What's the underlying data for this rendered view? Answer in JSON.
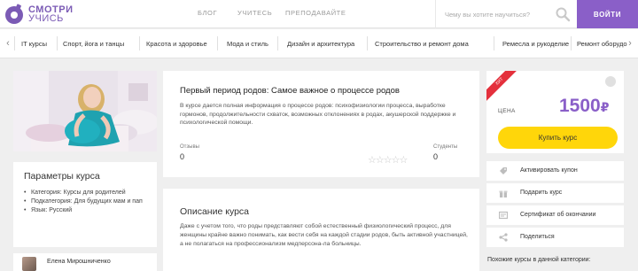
{
  "header": {
    "logo_line1": "СМОТРИ",
    "logo_line2": "УЧИСЬ",
    "nav": [
      "БЛОГ",
      "УЧИТЕСЬ",
      "ПРЕПОДАВАЙТЕ"
    ],
    "search_placeholder": "Чему вы хотите научиться?",
    "login_label": "ВОЙТИ",
    "accent_color": "#8a5fc8"
  },
  "categories": {
    "left_arrow": "‹",
    "right_arrow": "›",
    "items": [
      "IT курсы",
      "Спорт, йога и танцы",
      "Красота и здоровье",
      "Мода и стиль",
      "Дизайн и архитектура",
      "Строительство и ремонт дома",
      "Ремесла и рукоделие",
      "Ремонт оборудо"
    ]
  },
  "course": {
    "title": "Первый период родов: Самое важное о процессе родов",
    "description": "В курсе дается полная информация о процессе родов: психофизиологии процесса, выработке гормонов, продолжительности схваток, возможных отклонениях в родах, акушерской поддержке и психологической помощи.",
    "reviews_label": "Отзывы",
    "reviews_value": "0",
    "students_label": "Студенты",
    "students_value": "0",
    "rating_stars": 0
  },
  "params": {
    "title": "Параметры курса",
    "items": [
      "Категория: Курсы для родителей",
      "Подкатегория: Для будущих мам и пап",
      "Язык: Русский"
    ]
  },
  "author": {
    "name": "Елена Мирошниченко"
  },
  "description_section": {
    "title": "Описание курса",
    "body": "Даже с учетом того, что роды представляют собой естественный физиологический процесс, для женщины крайне важно понимать, как вести себя на каждой стадии родов, быть активной участницей, а не полагаться на профессионализм медперсона-ла больницы."
  },
  "pricing": {
    "ribbon": "ХИТ",
    "price_label": "ЦЕНА",
    "price": "1500",
    "currency": "₽",
    "buy_label": "Купить курс",
    "buy_color": "#ffd60a"
  },
  "actions": [
    {
      "label": "Активировать купон",
      "icon": "tag-icon"
    },
    {
      "label": "Подарить курс",
      "icon": "gift-icon"
    },
    {
      "label": "Сертификат об окончании",
      "icon": "certificate-icon"
    },
    {
      "label": "Поделиться",
      "icon": "share-icon"
    }
  ],
  "similar_title": "Похожие курсы в данной категории:"
}
